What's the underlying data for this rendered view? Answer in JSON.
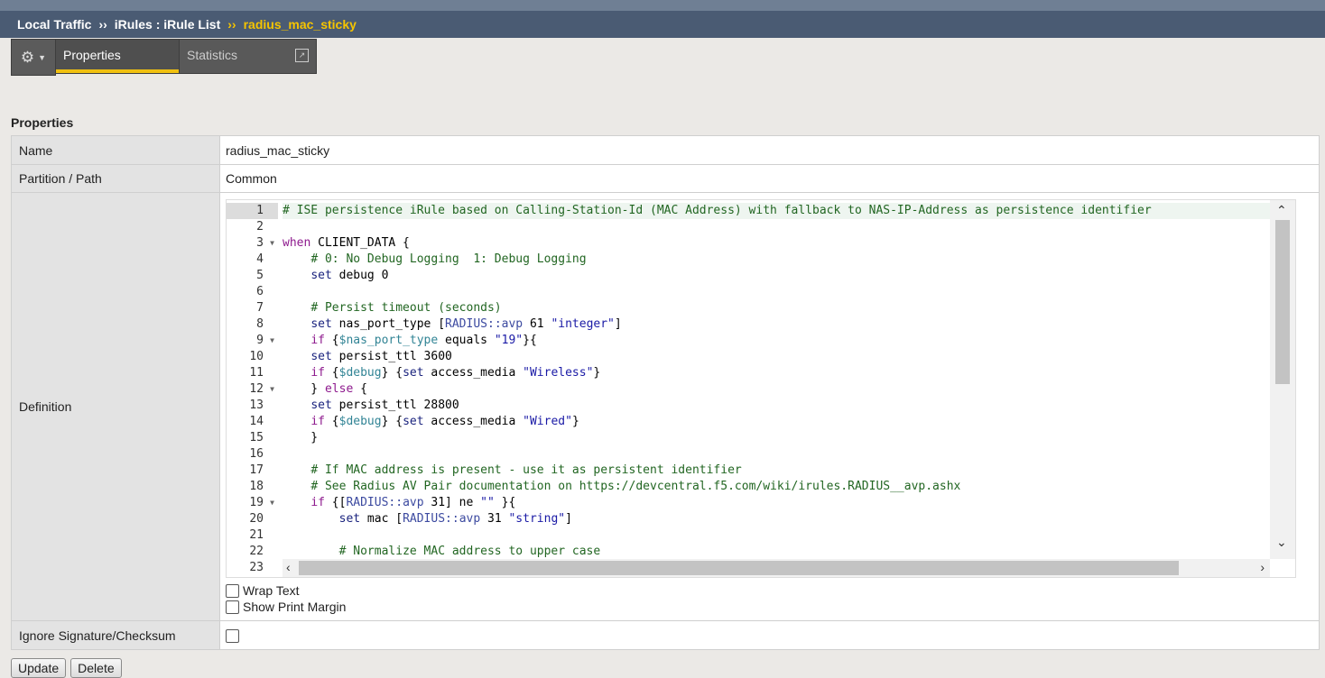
{
  "breadcrumb": {
    "section": "Local Traffic",
    "separator": "››",
    "parent": "iRules : iRule List",
    "current": "radius_mac_sticky"
  },
  "tabs": {
    "gear_icon": "gear-icon",
    "properties": "Properties",
    "statistics": "Statistics"
  },
  "properties": {
    "title": "Properties",
    "name_label": "Name",
    "name_value": "radius_mac_sticky",
    "partition_label": "Partition / Path",
    "partition_value": "Common",
    "definition_label": "Definition",
    "ignore_label": "Ignore Signature/Checksum",
    "ignore_checked": false
  },
  "editor": {
    "active_line": 1,
    "line_numbers": [
      "1",
      "2",
      "3",
      "4",
      "5",
      "6",
      "7",
      "8",
      "9",
      "10",
      "11",
      "12",
      "13",
      "14",
      "15",
      "16",
      "17",
      "18",
      "19",
      "20",
      "21",
      "22",
      "23"
    ],
    "fold_lines": [
      3,
      9,
      12,
      19
    ],
    "lines": [
      "# ISE persistence iRule based on Calling-Station-Id (MAC Address) with fallback to NAS-IP-Address as persistence identifier",
      "",
      "when CLIENT_DATA {",
      "    # 0: No Debug Logging  1: Debug Logging",
      "    set debug 0",
      "",
      "    # Persist timeout (seconds)",
      "    set nas_port_type [RADIUS::avp 61 \"integer\"]",
      "    if {$nas_port_type equals \"19\"}{",
      "    set persist_ttl 3600",
      "    if {$debug} {set access_media \"Wireless\"}",
      "    } else {",
      "    set persist_ttl 28800",
      "    if {$debug} {set access_media \"Wired\"}",
      "    }",
      "",
      "    # If MAC address is present - use it as persistent identifier",
      "    # See Radius AV Pair documentation on https://devcentral.f5.com/wiki/irules.RADIUS__avp.ashx",
      "    if {[RADIUS::avp 31] ne \"\" }{",
      "        set mac [RADIUS::avp 31 \"string\"]",
      "",
      "        # Normalize MAC address to upper case",
      ""
    ]
  },
  "options": {
    "wrap_text": "Wrap Text",
    "show_print_margin": "Show Print Margin"
  },
  "buttons": {
    "update": "Update",
    "delete": "Delete"
  }
}
